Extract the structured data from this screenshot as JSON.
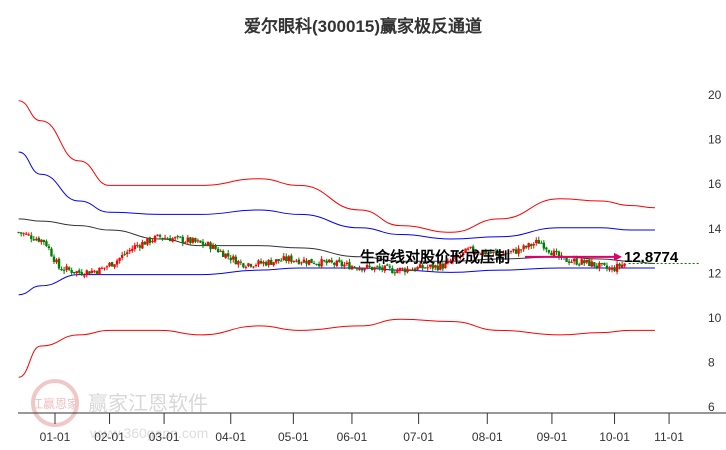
{
  "chart_data": {
    "type": "candlestick",
    "title": "爱尔眼科(300015)赢家极反通道",
    "ylim": [
      6,
      20
    ],
    "yticks": [
      20,
      18,
      16,
      14,
      12,
      10,
      8,
      6
    ],
    "xticks": [
      {
        "label": "01-01",
        "day": 0
      },
      {
        "label": "02-01",
        "day": 27
      },
      {
        "label": "03-01",
        "day": 54
      },
      {
        "label": "04-01",
        "day": 87
      },
      {
        "label": "05-01",
        "day": 118
      },
      {
        "label": "06-01",
        "day": 147
      },
      {
        "label": "07-01",
        "day": 180
      },
      {
        "label": "08-01",
        "day": 214
      },
      {
        "label": "09-01",
        "day": 246
      },
      {
        "label": "10-01",
        "day": 277
      },
      {
        "label": "11-01",
        "day": 304
      }
    ],
    "band_days": [
      -18,
      -7,
      12,
      27,
      52,
      72,
      101,
      121,
      151,
      171,
      196,
      220,
      250,
      270,
      285,
      297
    ],
    "bands": [
      {
        "name": "outer-upper",
        "color": "#ff0000",
        "values": [
          19.7,
          18.8,
          17.0,
          15.9,
          15.9,
          15.9,
          16.2,
          15.9,
          14.8,
          14.1,
          13.8,
          14.4,
          15.3,
          15.2,
          15.0,
          14.9
        ]
      },
      {
        "name": "inner-upper",
        "color": "#0000ff",
        "values": [
          17.4,
          16.4,
          15.2,
          14.7,
          14.6,
          14.6,
          14.8,
          14.6,
          14.0,
          13.7,
          13.5,
          13.6,
          14.0,
          14.0,
          13.9,
          13.9
        ]
      },
      {
        "name": "lifeline",
        "color": "#333333",
        "values": [
          14.4,
          14.3,
          14.1,
          13.9,
          13.5,
          13.2,
          13.2,
          13.1,
          12.7,
          12.5,
          12.5,
          12.6,
          12.7,
          12.6,
          12.5,
          12.4
        ]
      },
      {
        "name": "inner-lower",
        "color": "#0000ff",
        "values": [
          11.0,
          11.4,
          11.9,
          11.9,
          11.9,
          11.9,
          12.1,
          12.2,
          12.2,
          12.1,
          12.0,
          12.1,
          12.2,
          12.2,
          12.2,
          12.2
        ]
      },
      {
        "name": "outer-lower",
        "color": "#ff0000",
        "values": [
          7.3,
          8.7,
          9.2,
          9.4,
          9.4,
          9.2,
          9.6,
          9.4,
          9.6,
          9.9,
          9.8,
          9.4,
          9.2,
          9.3,
          9.4,
          9.4
        ]
      }
    ],
    "close_days": [
      -18,
      -5,
      2,
      12,
      22,
      30,
      40,
      52,
      67,
      77,
      92,
      101,
      116,
      136,
      156,
      168,
      181,
      193,
      205,
      220,
      230,
      240,
      250,
      265,
      275,
      282
    ],
    "close_values": [
      13.8,
      13.4,
      12.2,
      12.0,
      12.1,
      12.5,
      13.2,
      13.6,
      13.4,
      13.2,
      12.4,
      12.4,
      12.6,
      12.4,
      12.2,
      12.1,
      12.2,
      12.3,
      13.0,
      12.8,
      13.0,
      13.4,
      12.6,
      12.4,
      12.1,
      12.4
    ],
    "up_color": "#ff0000",
    "down_color": "#008000",
    "annotation": {
      "text": "生命线对股价形成压制",
      "value": "12.8774",
      "price": 12.8774,
      "arrow_color": "#e0006a"
    },
    "last_price": 12.4
  },
  "watermark": {
    "brand": "赢家江恩软件",
    "url": "www.360gann.com",
    "seal": "江赢恩家"
  }
}
